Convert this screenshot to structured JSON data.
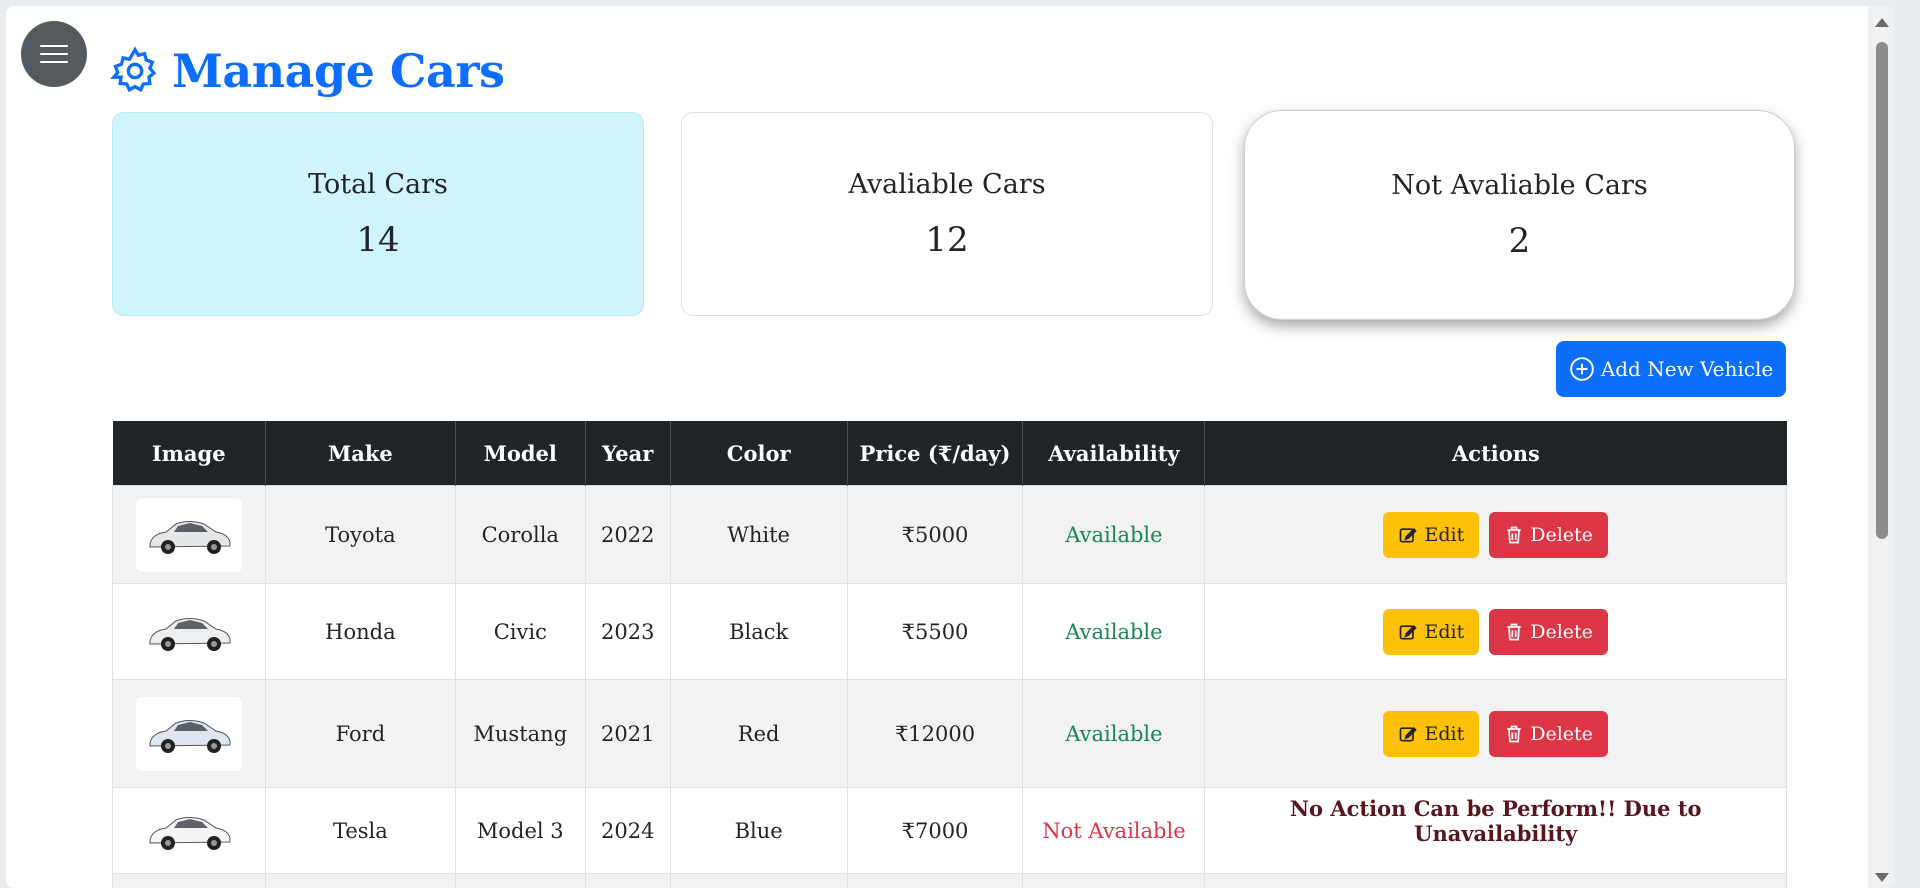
{
  "header": {
    "title": "Manage Cars"
  },
  "cards": {
    "total": {
      "label": "Total Cars",
      "value": "14"
    },
    "available": {
      "label": "Avaliable Cars",
      "value": "12"
    },
    "not_available": {
      "label": "Not Avaliable Cars",
      "value": "2"
    }
  },
  "add_button": {
    "label": "Add New Vehicle"
  },
  "table": {
    "headers": [
      "Image",
      "Make",
      "Model",
      "Year",
      "Color",
      "Price (₹/day)",
      "Availability",
      "Actions"
    ],
    "rows": [
      {
        "make": "Toyota",
        "model": "Corolla",
        "year": "2022",
        "color": "White",
        "price": "₹5000",
        "availability": "Available",
        "edit": "Edit",
        "delete": "Delete",
        "car_color": "#e6e7e9"
      },
      {
        "make": "Honda",
        "model": "Civic",
        "year": "2023",
        "color": "Black",
        "price": "₹5500",
        "availability": "Available",
        "edit": "Edit",
        "delete": "Delete",
        "car_color": "#eceeef"
      },
      {
        "make": "Ford",
        "model": "Mustang",
        "year": "2021",
        "color": "Red",
        "price": "₹12000",
        "availability": "Available",
        "edit": "Edit",
        "delete": "Delete",
        "car_color": "#dfe6f0"
      },
      {
        "make": "Tesla",
        "model": "Model 3",
        "year": "2024",
        "color": "Blue",
        "price": "₹7000",
        "availability": "Not Available",
        "no_action": "No Action Can be Perform!! Due to Unavailability",
        "car_color": "#f5f5f5"
      }
    ]
  },
  "colors": {
    "primary": "#0d6efd",
    "available": "#198754",
    "unavailable": "#dc3545",
    "edit": "#ffc107",
    "delete": "#dc3545",
    "header_bg": "#212529"
  }
}
